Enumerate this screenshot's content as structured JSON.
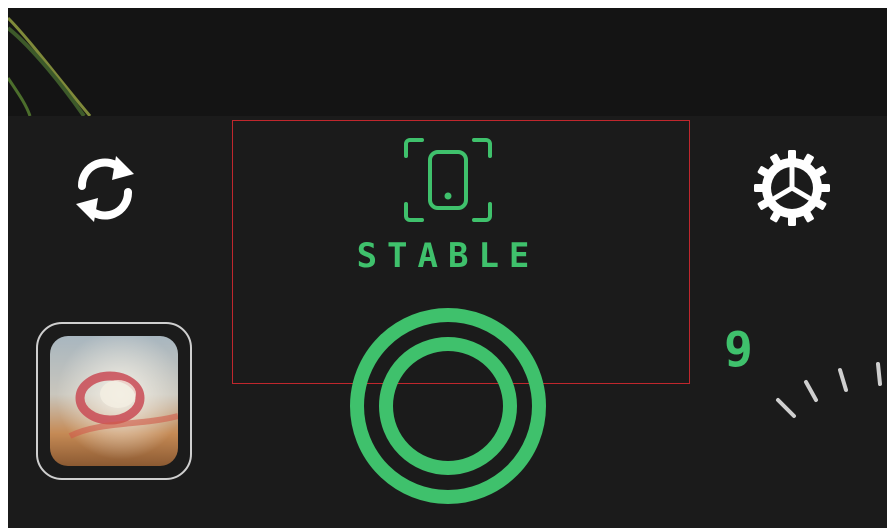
{
  "camera": {
    "status_label": "STABLE",
    "zoom_value": "9"
  },
  "icons": {
    "switch_camera": "refresh-arrows-icon",
    "settings": "gear-icon",
    "stable": "phone-focus-icon"
  },
  "colors": {
    "background": "#1b1b1b",
    "accent_green": "#3fc16c",
    "highlight_red": "#c0272d",
    "icon_white": "#ffffff"
  }
}
